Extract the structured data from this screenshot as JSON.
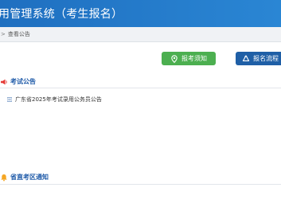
{
  "header": {
    "title": "用管理系统（考生报名）"
  },
  "breadcrumb": {
    "separator": ">",
    "current": "查看公告"
  },
  "toolbar": {
    "notice_label": "报考须知",
    "process_label": "报名流程"
  },
  "sections": {
    "exam_announcements": {
      "title": "考试公告",
      "items": [
        "广东省2025年考试录用公务员公告"
      ]
    },
    "provincial_notices": {
      "title": "省直考区通知"
    }
  },
  "colors": {
    "header_blue": "#2a86d4",
    "notice_button_green": "#4caf50",
    "process_button_blue": "#1f5fa6",
    "section_title_blue": "#1e5aa8"
  },
  "icons": {
    "notice_button": "location-pin-icon",
    "process_button": "recycle-flow-icon",
    "exam_section": "megaphone-icon",
    "provincial_section": "bell-icon",
    "list_bullet": "document-list-icon"
  }
}
